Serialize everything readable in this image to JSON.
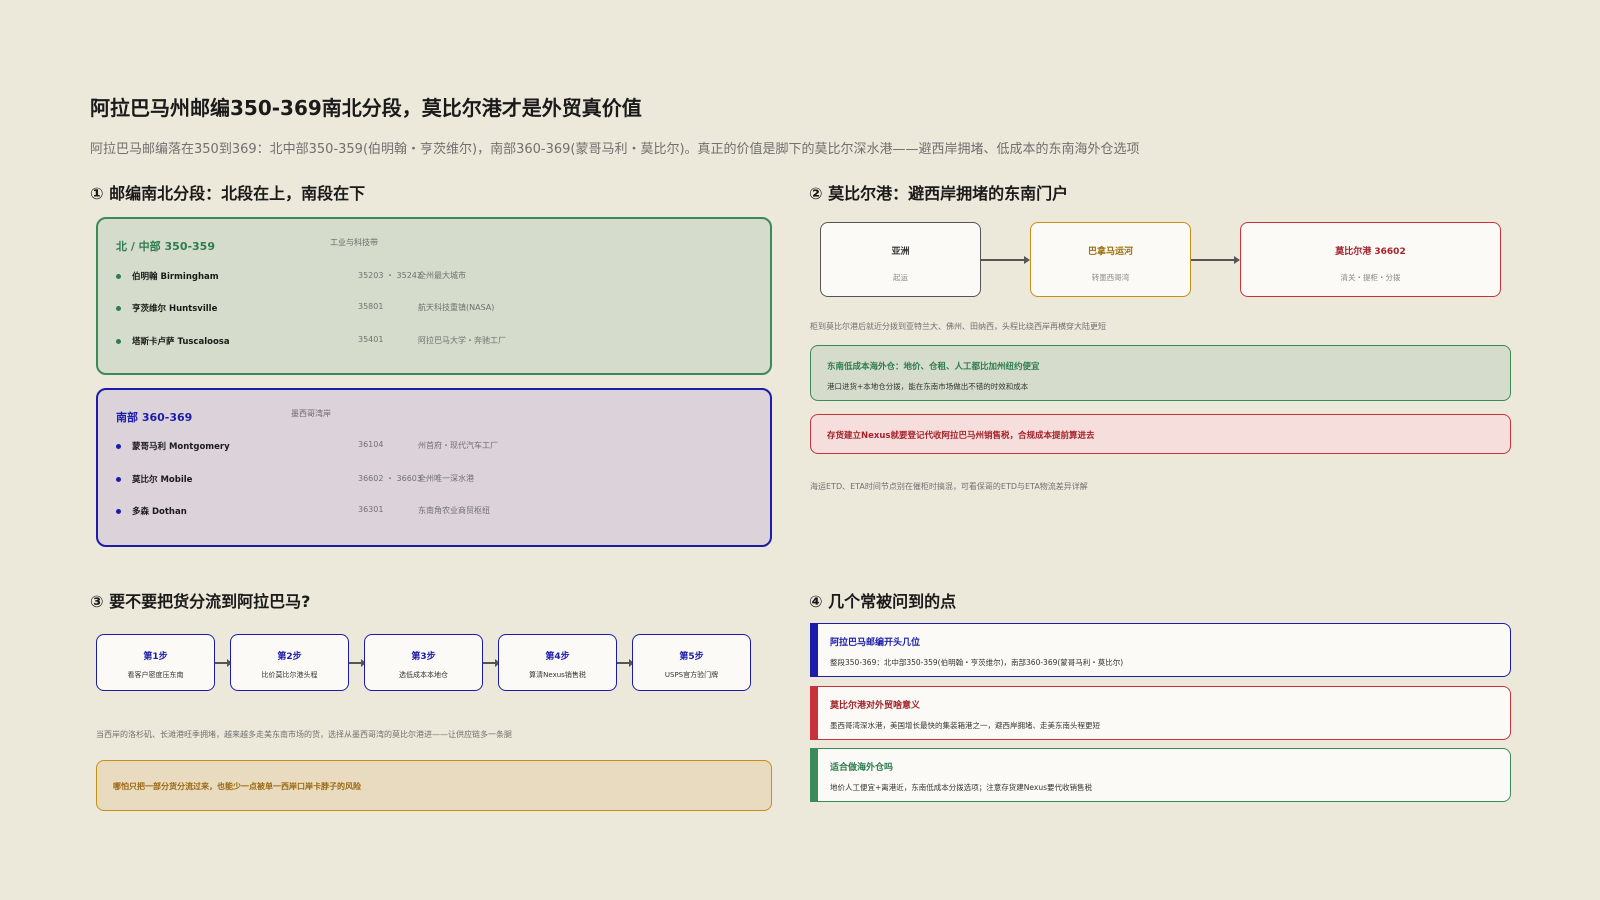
{
  "header": {
    "title": "阿拉巴马州邮编350-369南北分段，莫比尔港才是外贸真价值",
    "subtitle": "阿拉巴马邮编落在350到369：北中部350-359(伯明翰・亨茨维尔)，南部360-369(蒙哥马利・莫比尔)。真正的价值是脚下的莫比尔深水港——避西岸拥堵、低成本的东南海外仓选项"
  },
  "section1": {
    "title": "① 邮编南北分段：北段在上，南段在下",
    "north": {
      "head": "北 / 中部  350-359",
      "tag": "工业与科技带",
      "cities": [
        {
          "name": "伯明翰 Birmingham",
          "zip": "35203 ・ 35242",
          "desc": "全州最大城市"
        },
        {
          "name": "亨茨维尔 Huntsville",
          "zip": "35801",
          "desc": "航天科技重镇(NASA)"
        },
        {
          "name": "塔斯卡卢萨 Tuscaloosa",
          "zip": "35401",
          "desc": "阿拉巴马大学・奔驰工厂"
        }
      ]
    },
    "south": {
      "head": "南部  360-369",
      "tag": "墨西哥湾岸",
      "cities": [
        {
          "name": "蒙哥马利 Montgomery",
          "zip": "36104",
          "desc": "州首府・现代汽车工厂"
        },
        {
          "name": "莫比尔 Mobile",
          "zip": "36602 ・ 36603",
          "desc": "全州唯一深水港"
        },
        {
          "name": "多森 Dothan",
          "zip": "36301",
          "desc": "东南角农业商贸枢纽"
        }
      ]
    }
  },
  "section2": {
    "title": "② 莫比尔港：避西岸拥堵的东南门户",
    "flow": [
      {
        "title": "亚洲",
        "sub": "起运"
      },
      {
        "title": "巴拿马运河",
        "sub": "转墨西哥湾"
      },
      {
        "title": "莫比尔港 36602",
        "sub": "清关・提柜・分拨"
      }
    ],
    "note": "柜到莫比尔港后就近分拨到亚特兰大、佛州、田纳西，头程比绕西岸再横穿大陆更短",
    "callout_green": {
      "title": "东南低成本海外仓：地价、仓租、人工都比加州纽约便宜",
      "sub": "港口进货+本地仓分拨，能在东南市场做出不错的时效和成本"
    },
    "callout_red": {
      "title": "存货建立Nexus就要登记代收阿拉巴马州销售税，合规成本提前算进去"
    },
    "bottom_note": "海运ETD、ETA时间节点别在催柜时搞混，可看保哥的ETD与ETA物流差异详解"
  },
  "section3": {
    "title": "③ 要不要把货分流到阿拉巴马?",
    "steps": [
      {
        "title": "第1步",
        "sub": "看客户密度压东南"
      },
      {
        "title": "第2步",
        "sub": "比价莫比尔港头程"
      },
      {
        "title": "第3步",
        "sub": "选低成本本地仓"
      },
      {
        "title": "第4步",
        "sub": "算清Nexus销售税"
      },
      {
        "title": "第5步",
        "sub": "USPS官方验门牌"
      }
    ],
    "note": "当西岸的洛杉矶、长滩港旺季拥堵，越来越多走美东南市场的货，选择从墨西哥湾的莫比尔港进——让供应链多一条腿",
    "callout": "哪怕只把一部分货分流过来，也能少一点被单一西岸口岸卡脖子的风险"
  },
  "section4": {
    "title": "④ 几个常被问到的点",
    "faqs": [
      {
        "q": "阿拉巴马邮编开头几位",
        "a": "整段350-369：北中部350-359(伯明翰・亨茨维尔)，南部360-369(蒙哥马利・莫比尔)"
      },
      {
        "q": "莫比尔港对外贸啥意义",
        "a": "墨西哥湾深水港，美国增长最快的集装箱港之一，避西岸拥堵、走美东南头程更短"
      },
      {
        "q": "适合做海外仓吗",
        "a": "地价人工便宜+离港近，东南低成本分拨选项；注意存货建Nexus要代收销售税"
      }
    ]
  },
  "colors": {
    "background": "#ece8da",
    "green": "#2e7d4f",
    "blue": "#1c1caa",
    "red": "#c8323a",
    "amber": "#c49018"
  }
}
